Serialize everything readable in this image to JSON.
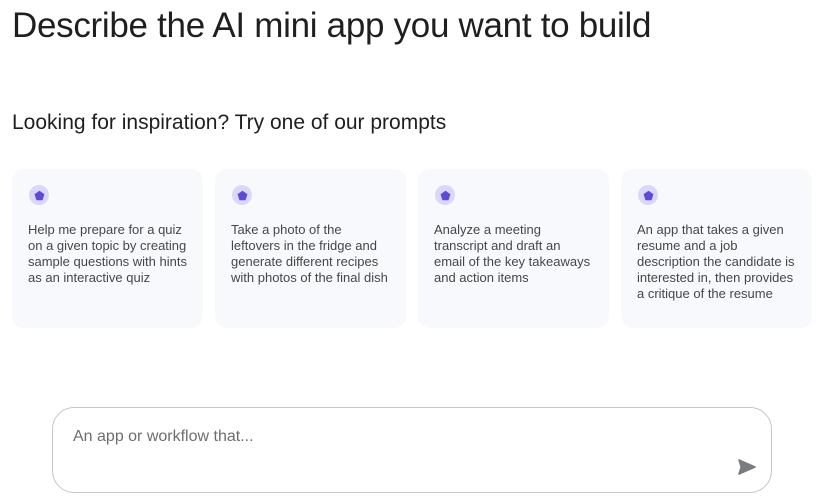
{
  "header": {
    "title": "Describe the AI mini app you want to build"
  },
  "inspiration": {
    "heading": "Looking for inspiration? Try one of our prompts",
    "icon": "pentagon-icon",
    "icon_color": "#5b4bd8",
    "icon_bg": "#dcd6fb",
    "cards": [
      {
        "text": "Help me prepare for a quiz on a given topic by creating sample questions with hints as an interactive quiz"
      },
      {
        "text": "Take a photo of the leftovers in the fridge and generate different recipes with photos of the final dish"
      },
      {
        "text": "Analyze a meeting transcript and draft an email of the key takeaways and action items"
      },
      {
        "text": "An app that takes a given resume and a job description the candidate is interested in, then provides a critique of the resume"
      }
    ]
  },
  "composer": {
    "placeholder": "An app or workflow that...",
    "value": "",
    "send_icon": "send-icon"
  }
}
